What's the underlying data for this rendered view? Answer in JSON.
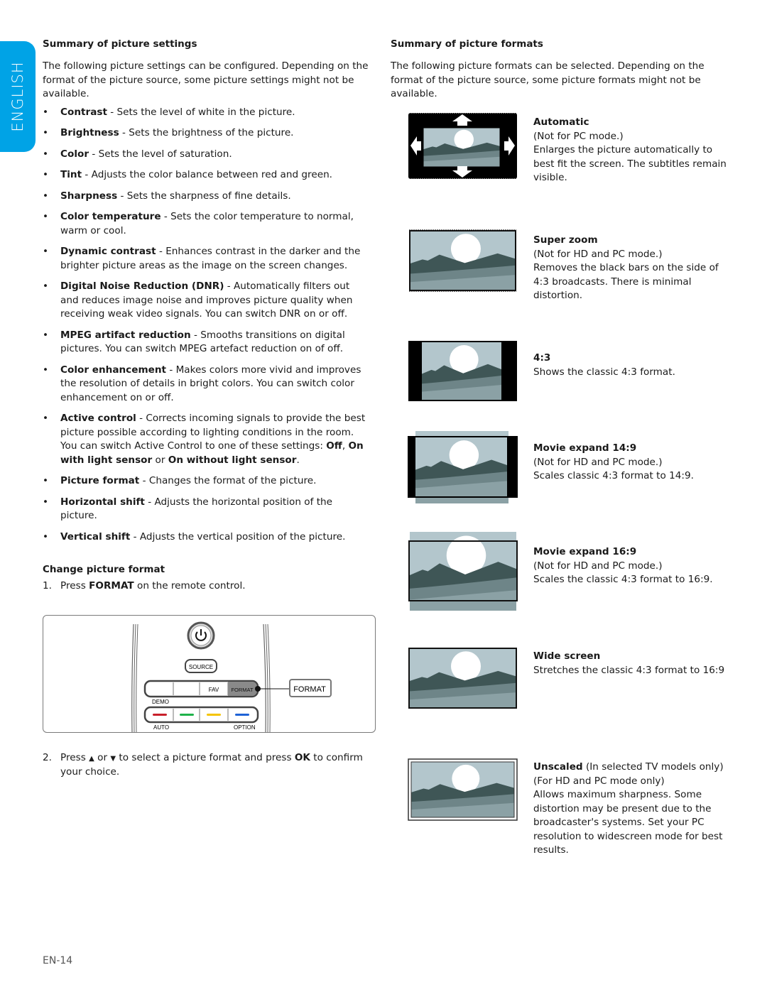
{
  "language_tab": "ENGLISH",
  "left": {
    "settings_heading": "Summary of picture settings",
    "settings_intro": "The following picture settings can be configured. Depending on the format of the picture source, some picture settings might not be available.",
    "settings": [
      {
        "term": "Contrast",
        "desc": " - Sets the level of white in the picture."
      },
      {
        "term": "Brightness",
        "desc": " - Sets the brightness of the picture."
      },
      {
        "term": "Color",
        "desc": " - Sets the level of saturation."
      },
      {
        "term": "Tint",
        "desc": " - Adjusts the color balance between red and green."
      },
      {
        "term": "Sharpness",
        "desc": " - Sets the sharpness of fine details."
      },
      {
        "term": "Color temperature",
        "desc": " - Sets the color temperature to normal, warm or cool."
      },
      {
        "term": "Dynamic contrast",
        "desc": " - Enhances contrast in the darker and the brighter picture areas as the image on the screen changes."
      },
      {
        "term": "Digital Noise Reduction (DNR)",
        "desc": " - Automatically filters out and reduces image noise and improves picture quality when receiving weak video signals. You can switch DNR on or off."
      },
      {
        "term": "MPEG artifact reduction",
        "desc": " - Smooths transitions on digital pictures. You can switch MPEG artefact reduction on of off."
      },
      {
        "term": "Color enhancement",
        "desc": " - Makes colors more vivid and improves the resolution of details in bright colors. You can switch color enhancement on or off."
      },
      {
        "term": "Active control",
        "desc": " - Corrects incoming signals to provide the best picture possible according to lighting conditions in the room. You can switch Active Control to one of these settings: ",
        "opt1": "Off",
        "sep1": ", ",
        "opt2": "On with light sensor",
        "sep2": " or ",
        "opt3": "On without light sensor",
        "end": "."
      },
      {
        "term": "Picture format",
        "desc": " - Changes the format of the picture."
      },
      {
        "term": "Horizontal shift",
        "desc": " - Adjusts the horizontal position of the picture."
      },
      {
        "term": "Vertical shift",
        "desc": " - Adjusts the vertical position of the picture."
      }
    ],
    "change_heading": "Change picture format",
    "step1": {
      "num": "1.",
      "pre": "Press ",
      "key": "FORMAT",
      "post": " on the remote control."
    },
    "step2": {
      "num": "2.",
      "pre": "Press ",
      "up": "▲",
      "mid": " or ",
      "down": "▼",
      "post1": " to select a picture format and press ",
      "key": "OK",
      "post2": " to confirm your choice."
    },
    "remote": {
      "source_label": "SOURCE",
      "fav_label": "FAV",
      "format_label": "FORMAT",
      "demo_label": "DEMO",
      "auto_label": "AUTO",
      "option_label": "OPTION",
      "callout_label": "FORMAT",
      "color_keys": [
        "#c8202a",
        "#1fb24a",
        "#f5c400",
        "#1f62d6"
      ]
    }
  },
  "right": {
    "formats_heading": "Summary of picture formats",
    "formats_intro": "The following picture formats can be selected. Depending on the format of the picture source, some picture formats might not be available.",
    "formats": [
      {
        "title": "Automatic",
        "lines": [
          "(Not for PC mode.)",
          "Enlarges the picture automatically to best fit the screen. The subtitles remain visible."
        ]
      },
      {
        "title": "Super zoom",
        "lines": [
          "(Not for HD and PC mode.)",
          "Removes the black bars on the side of 4:3 broadcasts. There is minimal distortion."
        ]
      },
      {
        "title": "4:3",
        "lines": [
          "Shows the classic 4:3 format."
        ]
      },
      {
        "title": "Movie expand 14:9",
        "lines": [
          "(Not for HD and PC mode.)",
          "Scales classic 4:3 format to 14:9."
        ]
      },
      {
        "title": "Movie expand 16:9",
        "lines": [
          "(Not for HD and PC mode.)",
          "Scales the classic 4:3 format to 16:9."
        ]
      },
      {
        "title": "Wide screen",
        "lines": [
          "Stretches the classic 4:3 format to 16:9"
        ]
      },
      {
        "title": "Unscaled",
        "title_suffix": " (In selected TV models only)",
        "lines": [
          "(For HD and PC mode only)",
          "Allows maximum sharpness. Some distortion may be present due to the broadcaster's systems.  Set your PC resolution to widescreen mode for best results."
        ]
      }
    ]
  },
  "colors": {
    "accent": "#00a3e6",
    "sky": "#b3c6cc",
    "mountain": "#3f5656",
    "band": "#6e8588",
    "ground": "#8ba1a5"
  },
  "page_number": "EN-14"
}
